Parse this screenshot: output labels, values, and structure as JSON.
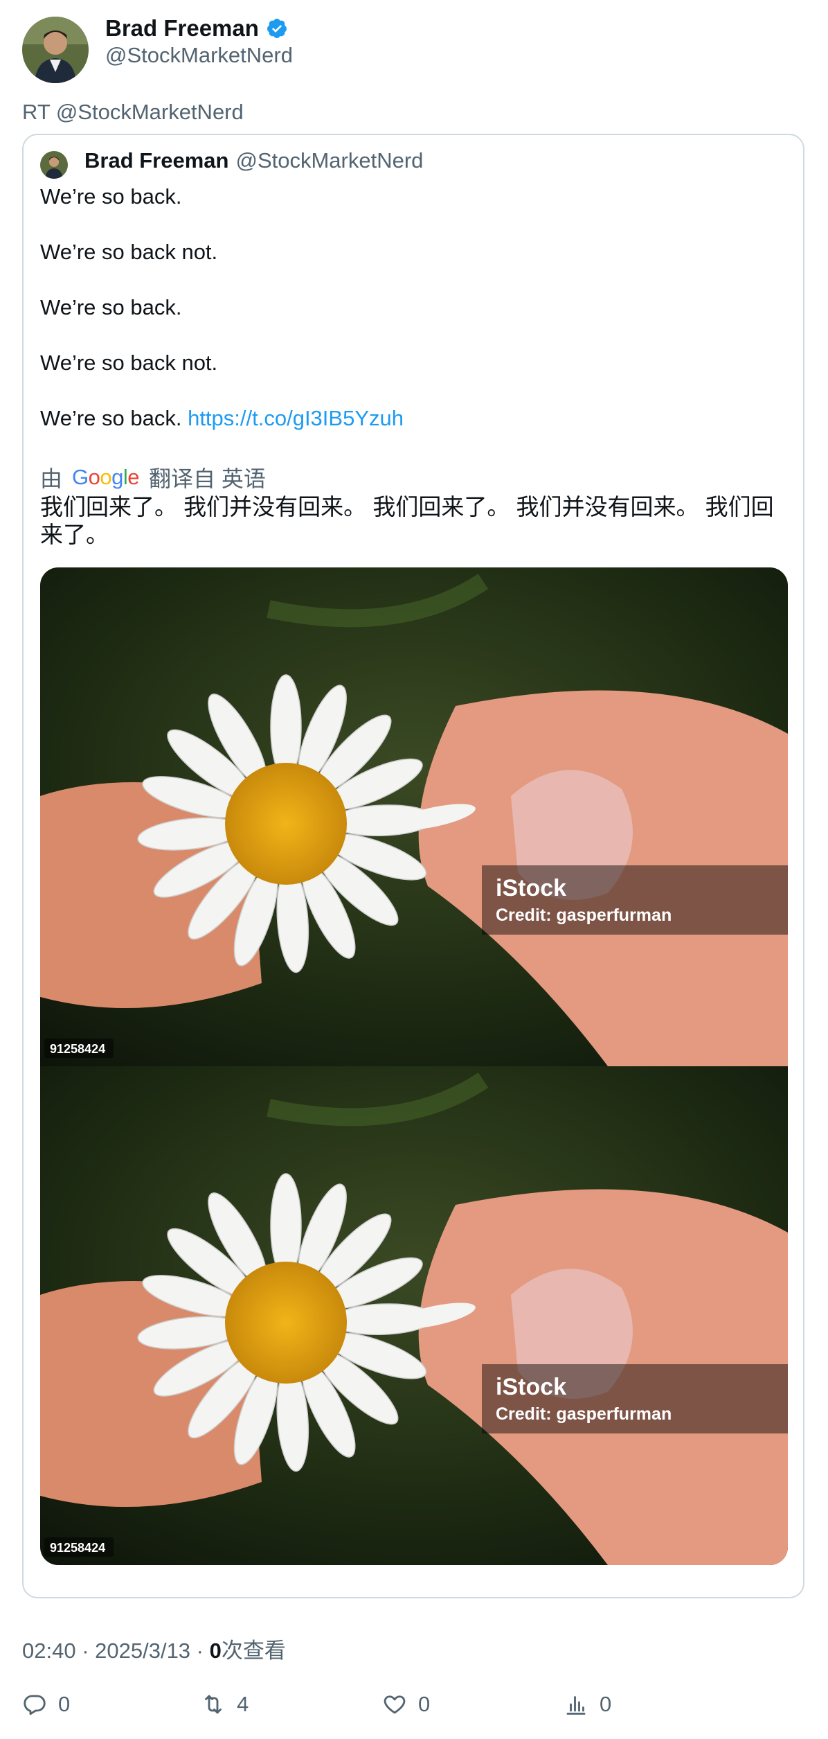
{
  "author": {
    "name": "Brad Freeman",
    "handle": "@StockMarketNerd",
    "verified": true,
    "verified_color": "#1d9bf0"
  },
  "retweet_line": "RT @StockMarketNerd",
  "quoted": {
    "name": "Brad Freeman",
    "handle": "@StockMarketNerd",
    "lines": [
      "We’re so back.",
      "We’re so back not.",
      "We’re so back.",
      "We’re so back not.",
      "We’re so back."
    ],
    "link": "https://t.co/gI3IB5Yzuh",
    "translate": {
      "prefix": "由",
      "provider": "Google",
      "suffix": "翻译自 英语"
    },
    "translated_text": "我们回来了。 我们并没有回来。 我们回来了。 我们并没有回来。 我们回来了。",
    "images": [
      {
        "brand": "iStock",
        "credit": "Credit: gasperfurman",
        "id": "91258424"
      },
      {
        "brand": "iStock",
        "credit": "Credit: gasperfurman",
        "id": "91258424"
      }
    ]
  },
  "meta": {
    "time": "02:40",
    "date": "2025/3/13",
    "views_count": "0",
    "views_label": "次查看"
  },
  "actions": {
    "replies": "0",
    "retweets": "4",
    "likes": "0",
    "views": "0"
  },
  "colors": {
    "text": "#0f1419",
    "secondary": "#536471",
    "link": "#1d9bf0",
    "border": "#cfd9de"
  }
}
